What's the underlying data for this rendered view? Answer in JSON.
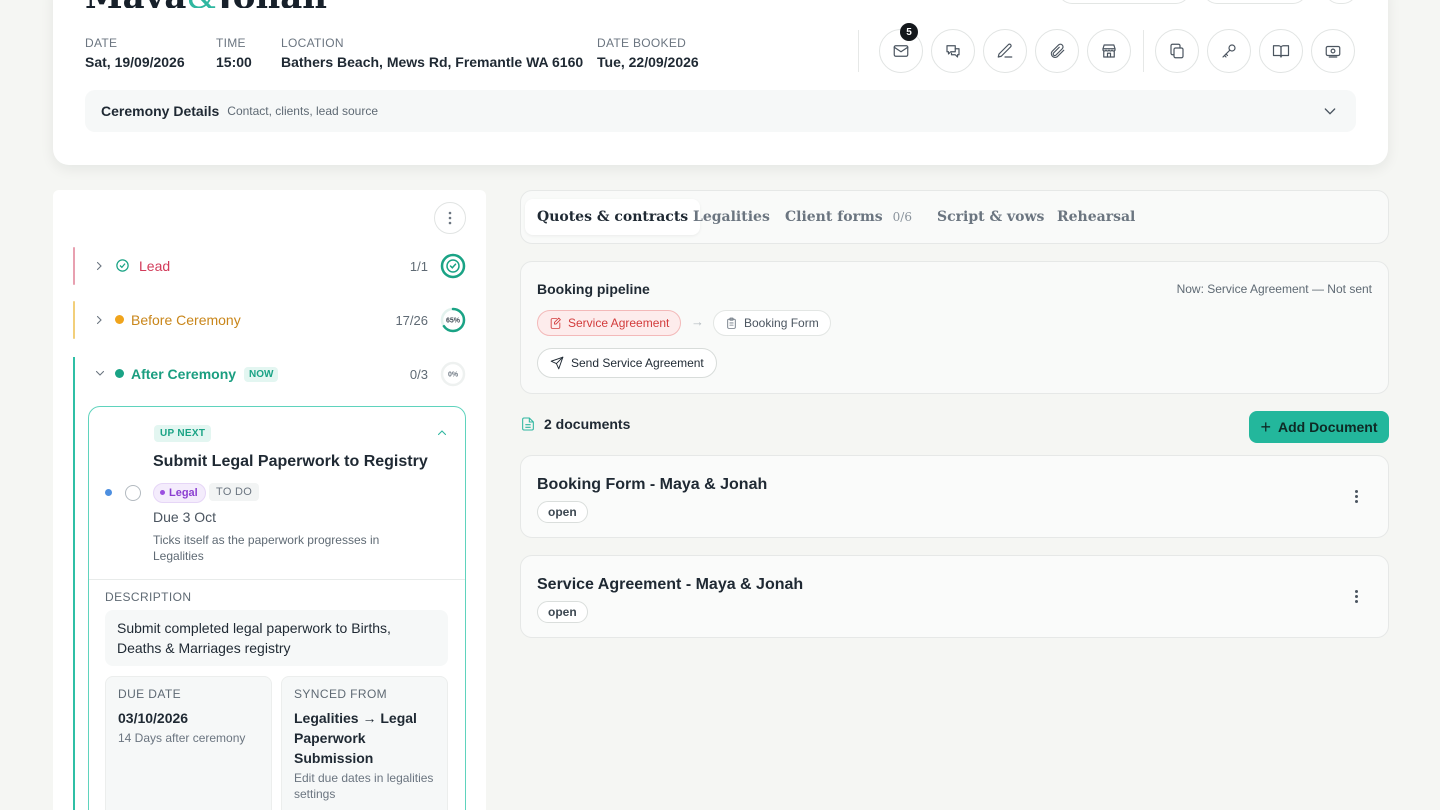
{
  "header": {
    "couple_name_first": "Maya",
    "couple_name_amp": "&",
    "couple_name_second": "Jonah",
    "meta": [
      {
        "label": "DATE",
        "value": "Sat, 19/09/2026"
      },
      {
        "label": "TIME",
        "value": "15:00"
      },
      {
        "label": "LOCATION",
        "value": "Bathers Beach, Mews Rd, Fremantle WA 6160"
      },
      {
        "label": "DATE BOOKED",
        "value": "Tue, 22/09/2026"
      }
    ],
    "actions": [
      {
        "icon": "mail-icon",
        "badge": "5"
      },
      {
        "icon": "chat-icon"
      },
      {
        "icon": "edit-icon"
      },
      {
        "icon": "attachment-icon"
      },
      {
        "icon": "store-icon"
      },
      {
        "icon": "copy-icon"
      },
      {
        "icon": "key-icon"
      },
      {
        "icon": "book-icon"
      },
      {
        "icon": "money-icon"
      }
    ],
    "ceremony_details": {
      "title": "Ceremony Details",
      "subtitle": "Contact, clients, lead source"
    }
  },
  "stages": [
    {
      "name": "Lead",
      "count": "1/1",
      "color": "#d23b5a",
      "bar_color": "#e8a0b0",
      "progress": 1.0
    },
    {
      "name": "Before Ceremony",
      "count": "17/26",
      "color": "#c9861a",
      "bar_color": "#f2cf7a",
      "progress": 0.65,
      "percent_label": "65%"
    },
    {
      "name": "After Ceremony",
      "count": "0/3",
      "color": "#1a9e80",
      "bar_color": "#2fbfa5",
      "tag": "NOW",
      "progress": 0.0,
      "percent_label": "0%"
    }
  ],
  "task": {
    "upnext": "UP NEXT",
    "title": "Submit Legal Paperwork to Registry",
    "tag": "Legal",
    "status": "TO DO",
    "due": "Due 3 Oct",
    "note": "Ticks itself as the paperwork progresses in Legalities",
    "description_label": "DESCRIPTION",
    "description": "Submit completed legal paperwork to Births, Deaths & Marriages registry",
    "due_date_label": "DUE DATE",
    "due_date": "03/10/2026",
    "due_date_note": "14 Days after ceremony",
    "synced_label": "SYNCED FROM",
    "synced_value": "Legalities → Legal Paperwork Submission",
    "synced_note": "Edit due dates in legalities settings"
  },
  "tabs": [
    {
      "label": "Quotes & contracts",
      "active": true
    },
    {
      "label": "Legalities"
    },
    {
      "label": "Client forms",
      "count": "0/6"
    },
    {
      "label": "Script & vows"
    },
    {
      "label": "Rehearsal"
    }
  ],
  "pipeline": {
    "title": "Booking pipeline",
    "status": "Now: Service Agreement — Not sent",
    "steps": [
      "Service Agreement",
      "Booking Form"
    ],
    "arrow": "→",
    "send_label": "Send Service Agreement"
  },
  "documents": {
    "count_label": "2 documents",
    "add_label": "Add Document",
    "add_plus": "+",
    "items": [
      {
        "title": "Booking Form - Maya & Jonah",
        "status": "open"
      },
      {
        "title": "Service Agreement - Maya & Jonah",
        "status": "open"
      }
    ]
  },
  "colors": {
    "accent": "#23b79c",
    "teal_border": "#5fd3bd"
  }
}
